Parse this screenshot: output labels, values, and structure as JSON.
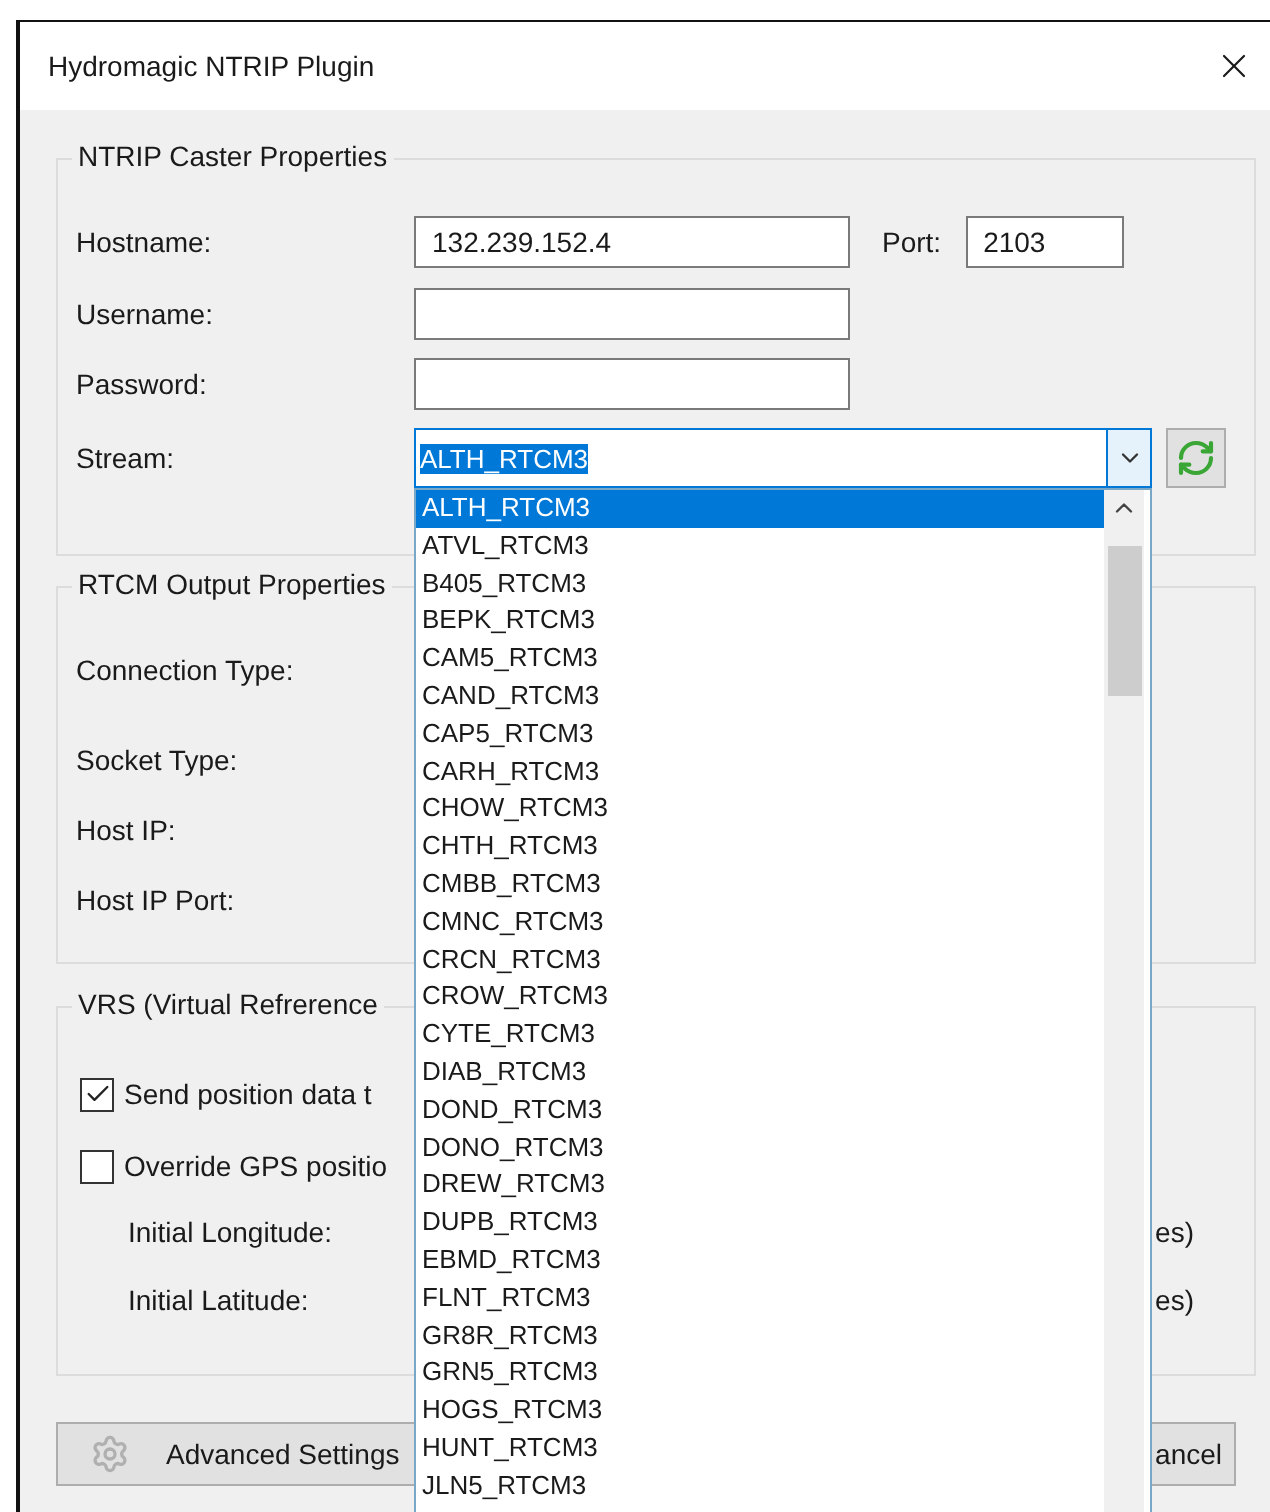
{
  "window": {
    "title": "Hydromagic NTRIP Plugin"
  },
  "caster": {
    "title": "NTRIP Caster Properties",
    "fields": [
      {
        "label": "Hostname:",
        "value": "132.239.152.4"
      },
      {
        "label": "Username:"
      },
      {
        "label": "Password:"
      }
    ],
    "port": {
      "label": "Port:",
      "value": "2103"
    },
    "stream": {
      "label": "Stream:",
      "value": "ALTH_RTCM3"
    }
  },
  "output": {
    "title": "RTCM Output Properties",
    "labels": [
      "Connection Type:",
      "Socket Type:",
      "Host IP:",
      "Host IP Port:"
    ]
  },
  "vrs": {
    "title": "VRS (Virtual Refrerence",
    "checks": [
      {
        "label": "Send position data t",
        "checked": true
      },
      {
        "label": "Override GPS positio",
        "checked": false
      }
    ],
    "coords": [
      {
        "label": "Initial Longitude:",
        "unit": "es)"
      },
      {
        "label": "Initial Latitude:",
        "unit": "es)"
      }
    ]
  },
  "buttons": {
    "advanced": "Advanced Settings",
    "cancel": "ancel"
  },
  "dropdown": {
    "items": [
      {
        "label": "ALTH_RTCM3",
        "selected": true
      },
      {
        "label": "ATVL_RTCM3",
        "selected": false
      },
      {
        "label": "B405_RTCM3",
        "selected": false
      },
      {
        "label": "BEPK_RTCM3",
        "selected": false
      },
      {
        "label": "CAM5_RTCM3",
        "selected": false
      },
      {
        "label": "CAND_RTCM3",
        "selected": false
      },
      {
        "label": "CAP5_RTCM3",
        "selected": false
      },
      {
        "label": "CARH_RTCM3",
        "selected": false
      },
      {
        "label": "CHOW_RTCM3",
        "selected": false
      },
      {
        "label": "CHTH_RTCM3",
        "selected": false
      },
      {
        "label": "CMBB_RTCM3",
        "selected": false
      },
      {
        "label": "CMNC_RTCM3",
        "selected": false
      },
      {
        "label": "CRCN_RTCM3",
        "selected": false
      },
      {
        "label": "CROW_RTCM3",
        "selected": false
      },
      {
        "label": "CYTE_RTCM3",
        "selected": false
      },
      {
        "label": "DIAB_RTCM3",
        "selected": false
      },
      {
        "label": "DOND_RTCM3",
        "selected": false
      },
      {
        "label": "DONO_RTCM3",
        "selected": false
      },
      {
        "label": "DREW_RTCM3",
        "selected": false
      },
      {
        "label": "DUPB_RTCM3",
        "selected": false
      },
      {
        "label": "EBMD_RTCM3",
        "selected": false
      },
      {
        "label": "FLNT_RTCM3",
        "selected": false
      },
      {
        "label": "GR8R_RTCM3",
        "selected": false
      },
      {
        "label": "GRN5_RTCM3",
        "selected": false
      },
      {
        "label": "HOGS_RTCM3",
        "selected": false
      },
      {
        "label": "HUNT_RTCM3",
        "selected": false
      },
      {
        "label": "JLN5_RTCM3",
        "selected": false
      }
    ]
  }
}
